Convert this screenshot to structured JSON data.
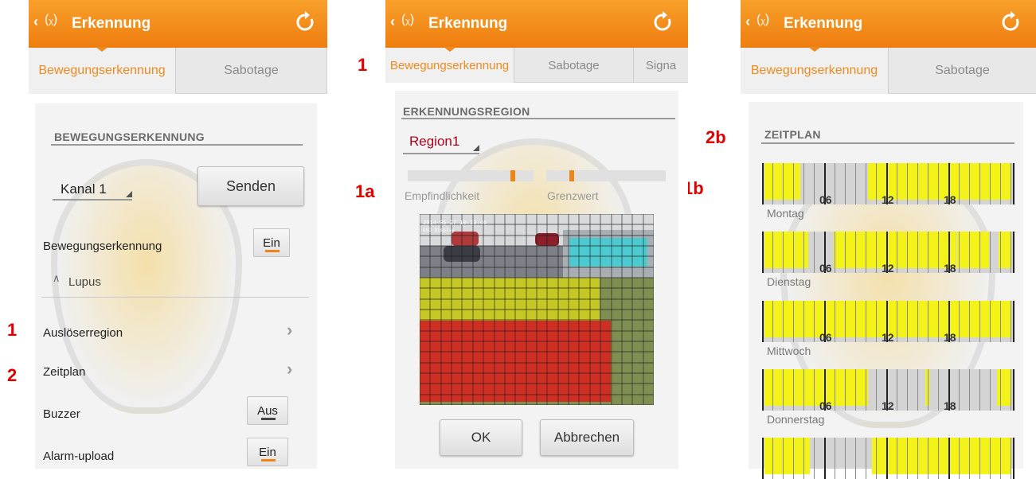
{
  "markers": {
    "m1_left": "1",
    "m2_left": "2",
    "m1_mid": "1",
    "m1a": "1a",
    "m1b": "1b",
    "m2b": "2b"
  },
  "titlebar": {
    "back_icon": "chevron-left-icon",
    "signal_icon": "wireless-signal-icon",
    "title": "Erkennung",
    "refresh_icon": "refresh-icon",
    "color": "#ef7d10"
  },
  "tabs": {
    "motion": "Bewegungserkennung",
    "sabotage": "Sabotage",
    "signal": "Signa",
    "active_color": "#ef8a1c"
  },
  "panel1": {
    "section_title": "BEWEGUNGSERKENNUNG",
    "channel_value": "Kanal 1",
    "send_button": "Senden",
    "motion_label": "Bewegungserkennung",
    "motion_toggle": "Ein",
    "group_label": "Lupus",
    "trigger_region": "Auslöserregion",
    "schedule": "Zeitplan",
    "buzzer_label": "Buzzer",
    "buzzer_toggle": "Aus",
    "upload_label": "Alarm-upload",
    "upload_toggle": "Ein"
  },
  "panel2": {
    "section_title": "ERKENNUNGSREGION",
    "region_value": "Region1",
    "sensitivity_label": "Empfindlichkeit",
    "threshold_label": "Grenzwert",
    "sensitivity_level": 0.85,
    "threshold_level": 0.2,
    "ok_button": "OK",
    "cancel_button": "Abbrechen",
    "region_colors": {
      "cyan": "#2fd3d8",
      "yellow": "#d7d41a",
      "red": "#e01818"
    }
  },
  "panel3": {
    "section_title": "ZEITPLAN",
    "hour_labels": [
      "06",
      "12",
      "18"
    ],
    "days": [
      "Montag",
      "Dienstag",
      "Mittwoch",
      "Donnerstag"
    ],
    "active_color": "#f3f31a"
  }
}
